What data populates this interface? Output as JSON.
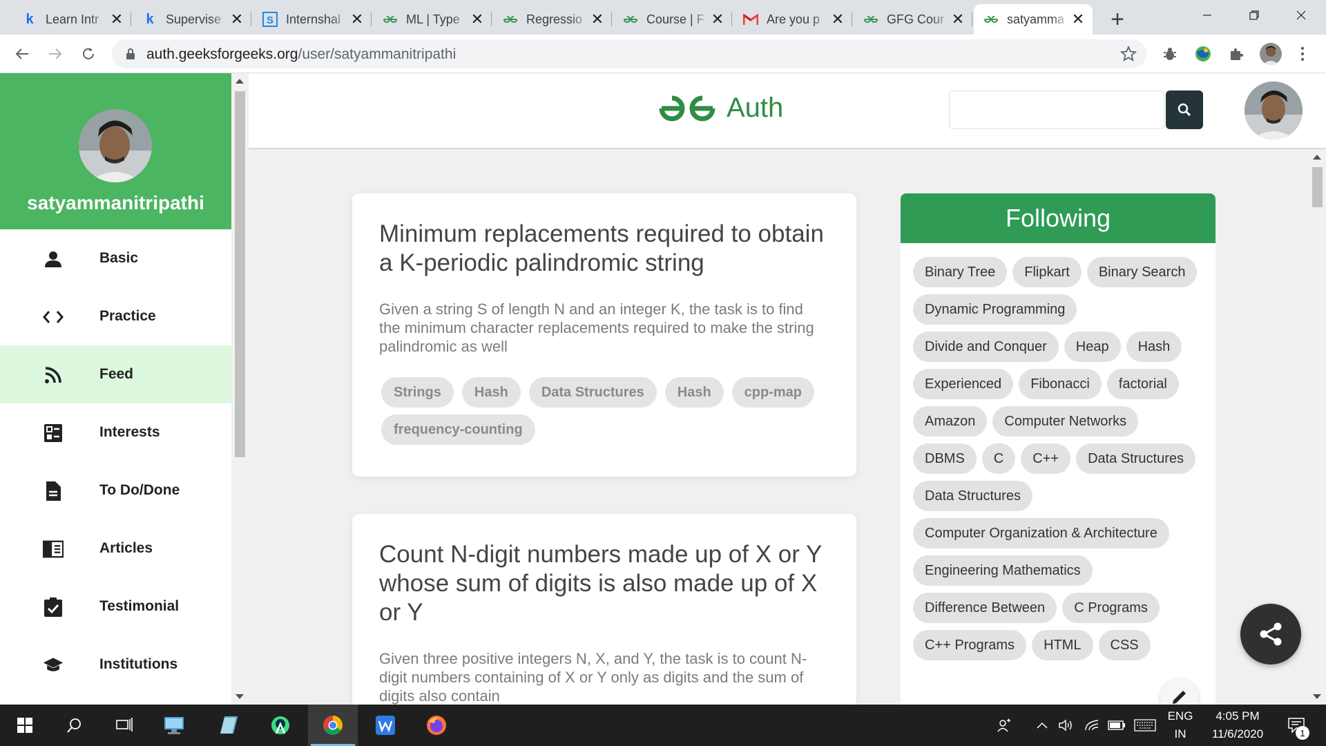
{
  "browser": {
    "tabs": [
      {
        "title": "Learn Intr",
        "icon": "k-logo-icon"
      },
      {
        "title": "Supervise",
        "icon": "k-logo-icon"
      },
      {
        "title": "Internshal",
        "icon": "internshala-icon"
      },
      {
        "title": "ML | Type",
        "icon": "gfg-icon"
      },
      {
        "title": "Regressio",
        "icon": "gfg-icon"
      },
      {
        "title": "Course | F",
        "icon": "gfg-icon"
      },
      {
        "title": "Are you p",
        "icon": "gmail-icon"
      },
      {
        "title": "GFG Cour",
        "icon": "gfg-icon"
      },
      {
        "title": "satyamma",
        "icon": "gfg-icon",
        "active": true
      }
    ],
    "url_host": "auth.geeksforgeeks.org",
    "url_path": "/user/satyammanitripathi"
  },
  "sidebar": {
    "username": "satyammanitripathi",
    "items": [
      {
        "label": "Basic",
        "icon": "person-icon"
      },
      {
        "label": "Practice",
        "icon": "code-icon"
      },
      {
        "label": "Feed",
        "icon": "rss-icon",
        "active": true
      },
      {
        "label": "Interests",
        "icon": "list-icon"
      },
      {
        "label": "To Do/Done",
        "icon": "document-icon"
      },
      {
        "label": "Articles",
        "icon": "article-icon"
      },
      {
        "label": "Testimonial",
        "icon": "clipboard-check-icon"
      },
      {
        "label": "Institutions",
        "icon": "school-icon"
      }
    ]
  },
  "header": {
    "logo_text": "Auth",
    "search_placeholder": ""
  },
  "feed": [
    {
      "title": "Minimum replacements required to obtain a K-periodic palindromic string",
      "description": "Given a string S of length N and an integer K, the task is to find the minimum character replacements required to make the string palindromic as well",
      "tags": [
        "Strings",
        "Hash",
        "Data Structures",
        "Hash",
        "cpp-map",
        "frequency-counting"
      ]
    },
    {
      "title": "Count N-digit numbers made up of X or Y whose sum of digits is also made up of X or Y",
      "description": "Given three positive integers N, X, and Y, the task is to count N-digit numbers containing of X or Y only as digits and the sum of digits also contain",
      "tags": []
    }
  ],
  "following": {
    "title": "Following",
    "tags": [
      "Binary Tree",
      "Flipkart",
      "Binary Search",
      "Dynamic Programming",
      "Divide and Conquer",
      "Heap",
      "Hash",
      "Experienced",
      "Fibonacci",
      "factorial",
      "Amazon",
      "Computer Networks",
      "DBMS",
      "C",
      "C++",
      "Data Structures",
      "Data Structures",
      "Computer Organization & Architecture",
      "Engineering Mathematics",
      "Difference Between",
      "C Programs",
      "C++ Programs",
      "HTML",
      "CSS"
    ]
  },
  "taskbar": {
    "lang_top": "ENG",
    "lang_bottom": "IN",
    "time": "4:05 PM",
    "date": "11/6/2020",
    "notification_count": "1"
  },
  "colors": {
    "gfg_green": "#2f8d46",
    "sidebar_header": "#4cb562",
    "feed_active": "#dcf9e0",
    "following_header": "#2f9b55"
  }
}
